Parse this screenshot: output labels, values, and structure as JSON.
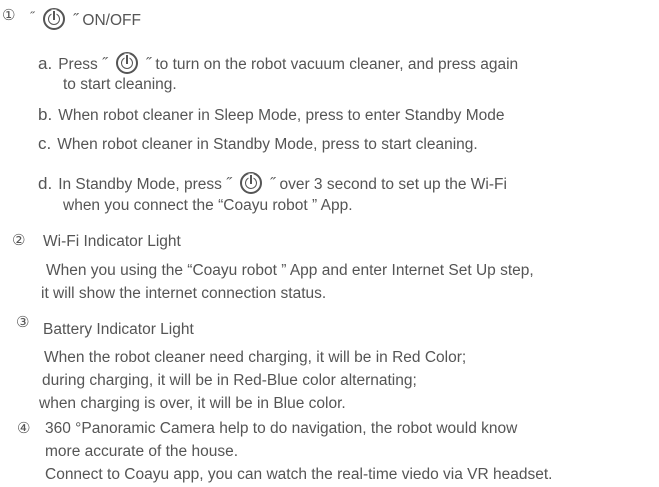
{
  "items": [
    {
      "marker": "①",
      "title_prefix": "˝",
      "title_suffix": "˝ ON/OFF",
      "subitems": [
        {
          "letter": "a.",
          "before": "Press ˝",
          "after": "˝ to turn on the robot vacuum cleaner, and press again",
          "line2": "to start cleaning."
        },
        {
          "letter": "b.",
          "text": "When robot cleaner in Sleep Mode, press to enter Standby Mode"
        },
        {
          "letter": "c.",
          "text": "When robot cleaner in Standby Mode, press to start cleaning."
        },
        {
          "letter": "d.",
          "before": "In Standby Mode,  press ˝",
          "after": "˝ over 3 second to set up the Wi-Fi",
          "line2": "when you connect the “Coayu robot ” App."
        }
      ]
    },
    {
      "marker": "②",
      "title": "Wi-Fi Indicator Light",
      "lines": [
        "When you using the “Coayu robot ” App and enter Internet Set Up step,",
        "it will show the internet connection status."
      ]
    },
    {
      "marker": "③",
      "title": "Battery Indicator Light",
      "lines": [
        "When the robot cleaner need charging, it will be in Red Color;",
        "during charging, it will be in Red-Blue color alternating;",
        "when charging is over, it will be in Blue color."
      ]
    },
    {
      "marker": "④",
      "lines": [
        "360 °Panoramic Camera help to do navigation,  the robot would know",
        "more accurate of the house.",
        "Connect to Coayu app, you can watch the real-time viedo via VR headset."
      ]
    }
  ],
  "icons": {
    "power": "power-icon"
  }
}
